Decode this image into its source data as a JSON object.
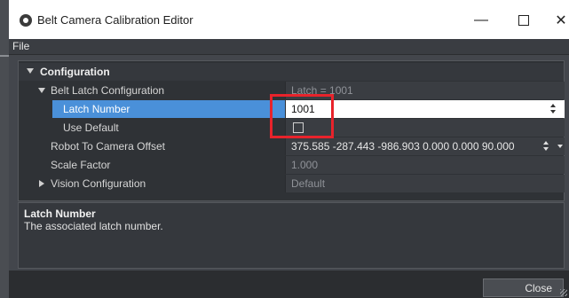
{
  "window": {
    "title": "Belt Camera Calibration Editor",
    "icon": "record-icon"
  },
  "menu": {
    "file": "File"
  },
  "grid": {
    "category": "Configuration",
    "rows": [
      {
        "name": "Belt Latch Configuration",
        "value": "Latch = 1001"
      },
      {
        "name": "Latch Number",
        "value": "1001"
      },
      {
        "name": "Use Default",
        "checked": false
      },
      {
        "name": "Robot To Camera Offset",
        "value": "375.585 -287.443 -986.903 0.000 0.000 90.000"
      },
      {
        "name": "Scale Factor",
        "value": "1.000"
      },
      {
        "name": "Vision Configuration",
        "value": "Default"
      }
    ]
  },
  "description": {
    "title": "Latch Number",
    "text": "The associated latch number."
  },
  "footer": {
    "close": "Close"
  },
  "colors": {
    "highlight": "#e8232b",
    "selection": "#4a90d9"
  }
}
